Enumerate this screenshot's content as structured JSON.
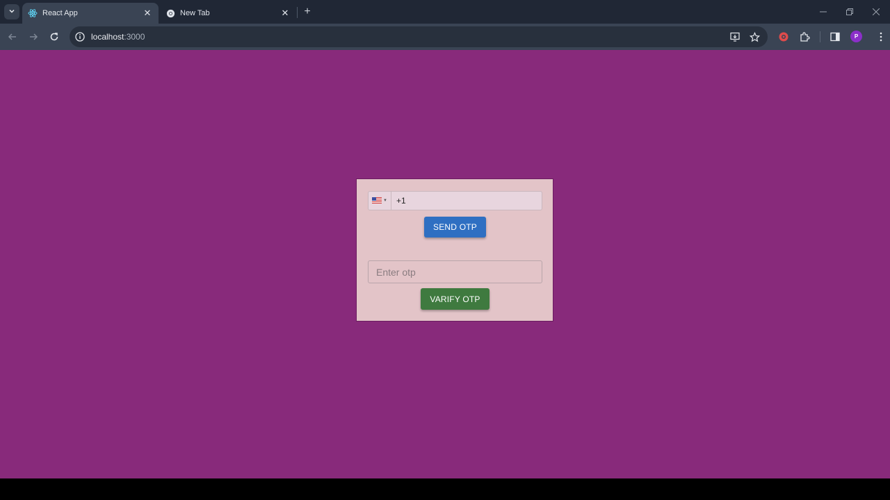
{
  "browser": {
    "tabs": [
      {
        "title": "React App",
        "active": true,
        "icon": "react-logo-icon"
      },
      {
        "title": "New Tab",
        "active": false,
        "icon": "chrome-logo-icon"
      }
    ],
    "new_tab_label": "+",
    "address": {
      "host": "localhost",
      "port": ":3000"
    },
    "profile_initial": "P"
  },
  "page": {
    "background_color": "#882a7b",
    "card_color": "#e3c4c8"
  },
  "form": {
    "phone": {
      "country_flag": "us-flag-icon",
      "value": "+1"
    },
    "send_button_label": "SEND OTP",
    "send_button_color": "#2f6fc2",
    "otp": {
      "placeholder": "Enter otp",
      "value": ""
    },
    "verify_button_label": "VARIFY OTP",
    "verify_button_color": "#3f7a3f"
  }
}
